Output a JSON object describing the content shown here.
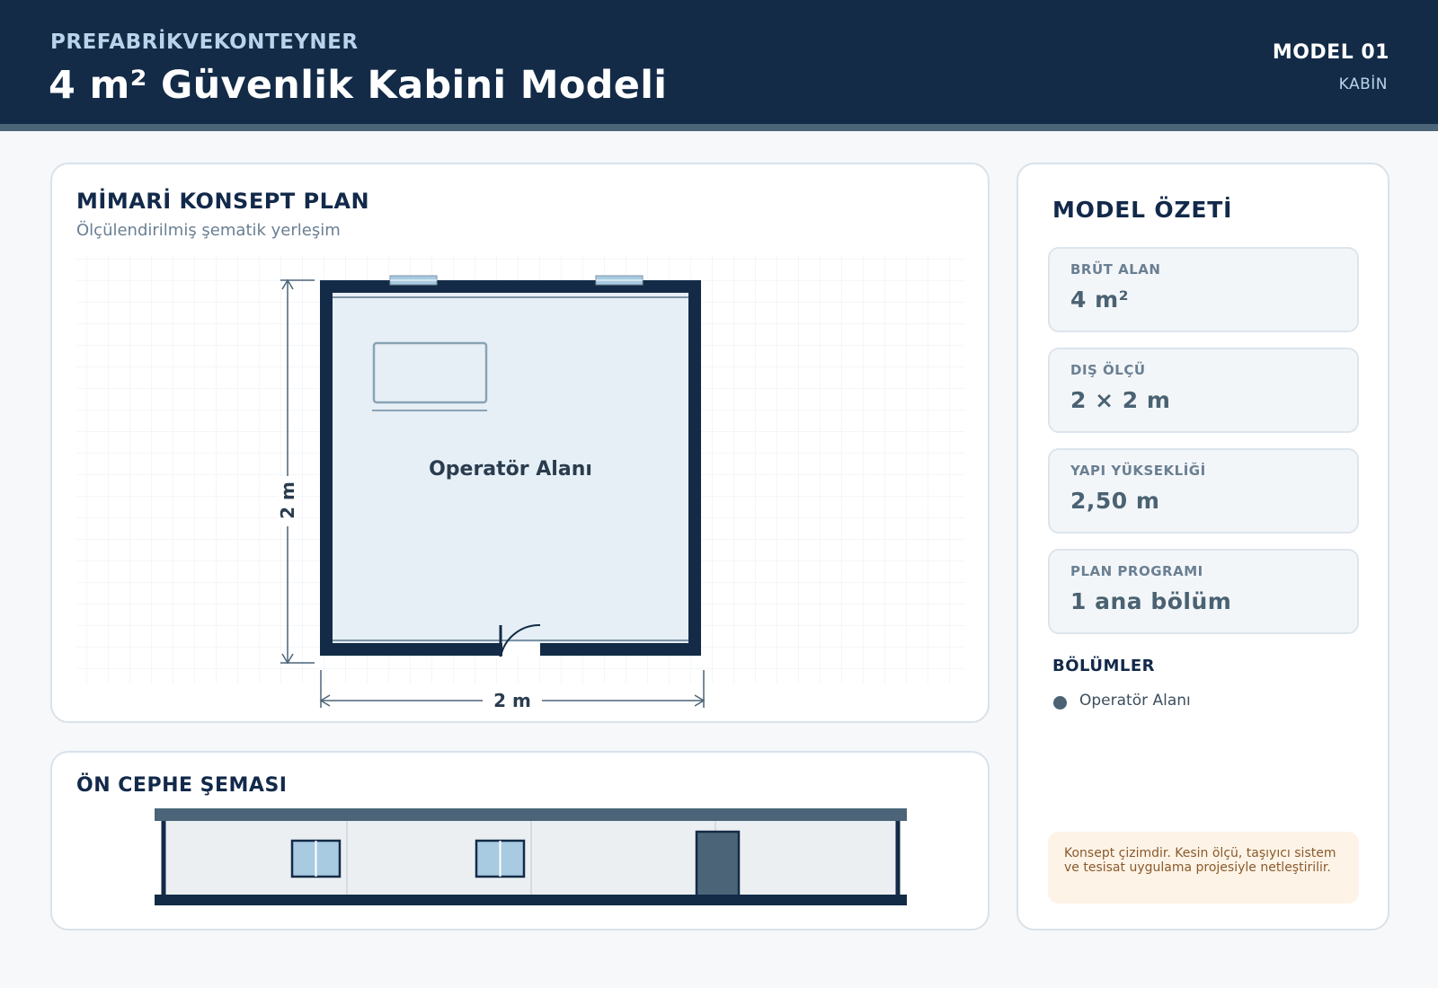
{
  "header": {
    "brand": "PREFABRİKVEKONTEYNER",
    "title": "4 m² Güvenlik Kabini Modeli",
    "model_no": "MODEL 01",
    "model_type": "KABİN"
  },
  "plan": {
    "title": "MİMARİ KONSEPT PLAN",
    "subtitle": "Ölçülendirilmiş şematik yerleşim",
    "room_label": "Operatör Alanı",
    "width_label": "2 m",
    "depth_label": "2 m"
  },
  "front": {
    "title": "ÖN CEPHE ŞEMASI"
  },
  "summary": {
    "title": "MODEL ÖZETİ",
    "stats": [
      {
        "label": "BRÜT ALAN",
        "value": "4 m²"
      },
      {
        "label": "DIŞ ÖLÇÜ",
        "value": "2 × 2 m"
      },
      {
        "label": "YAPI YÜKSEKLİĞİ",
        "value": "2,50 m"
      },
      {
        "label": "PLAN PROGRAMI",
        "value": "1 ana bölüm"
      }
    ],
    "sections_title": "BÖLÜMLER",
    "sections": [
      "Operatör Alanı"
    ],
    "note": "Konsept çizimdir. Kesin ölçü, taşıyıcı sistem ve tesisat uygulama projesiyle netleştirilir."
  },
  "colors": {
    "navy": "#132b47",
    "slate": "#4b6478",
    "room_fill": "#e6eff5",
    "window_blue": "#a8cbe2"
  }
}
